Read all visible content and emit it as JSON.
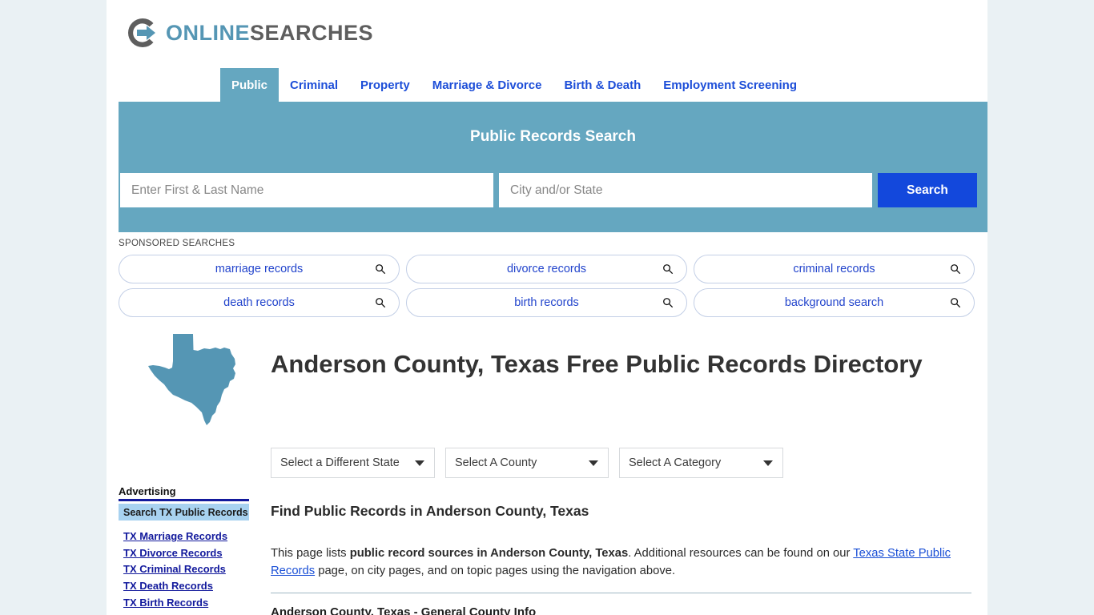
{
  "brand": {
    "name_part1": "ONLINE",
    "name_part2": "SEARCHES",
    "accent_color": "#5596b4",
    "gray_color": "#5e5e5e"
  },
  "nav": {
    "items": [
      {
        "label": "Public",
        "active": true
      },
      {
        "label": "Criminal",
        "active": false
      },
      {
        "label": "Property",
        "active": false
      },
      {
        "label": "Marriage & Divorce",
        "active": false
      },
      {
        "label": "Birth & Death",
        "active": false
      },
      {
        "label": "Employment Screening",
        "active": false
      }
    ],
    "active_bg": "#65a7c0",
    "link_color": "#1d4ed8"
  },
  "banner": {
    "title": "Public Records Search",
    "bg_color": "#65a7c0",
    "name_placeholder": "Enter First & Last Name",
    "name_value": "",
    "city_placeholder": "City and/or State",
    "city_value": "",
    "search_button": "Search",
    "search_button_color": "#1348dc"
  },
  "sponsored": {
    "label": "SPONSORED SEARCHES",
    "pills": [
      {
        "label": "marriage records"
      },
      {
        "label": "divorce records"
      },
      {
        "label": "criminal records"
      },
      {
        "label": "death records"
      },
      {
        "label": "birth records"
      },
      {
        "label": "background search"
      }
    ]
  },
  "main": {
    "page_title": "Anderson County, Texas Free Public Records Directory",
    "map_state": "Texas",
    "map_color": "#5596b4",
    "selects": [
      {
        "label": "Select a Different State"
      },
      {
        "label": "Select A County"
      },
      {
        "label": "Select A Category"
      }
    ],
    "section_heading": "Find Public Records in Anderson County, Texas",
    "paragraph": {
      "part1": "This page lists ",
      "bold": "public record sources in Anderson County, Texas",
      "part2": ". Additional resources can be found on our ",
      "link": "Texas State Public Records",
      "part3": " page, on city pages, and on topic pages using the navigation above."
    },
    "table_heading": "Anderson County, Texas - General County Info"
  },
  "sidebar": {
    "heading": "Advertising",
    "section_title": "Search TX Public Records",
    "links": [
      {
        "label": "TX Marriage Records"
      },
      {
        "label": "TX Divorce Records"
      },
      {
        "label": "TX Criminal Records"
      },
      {
        "label": "TX Death Records"
      },
      {
        "label": "TX Birth Records"
      }
    ]
  }
}
